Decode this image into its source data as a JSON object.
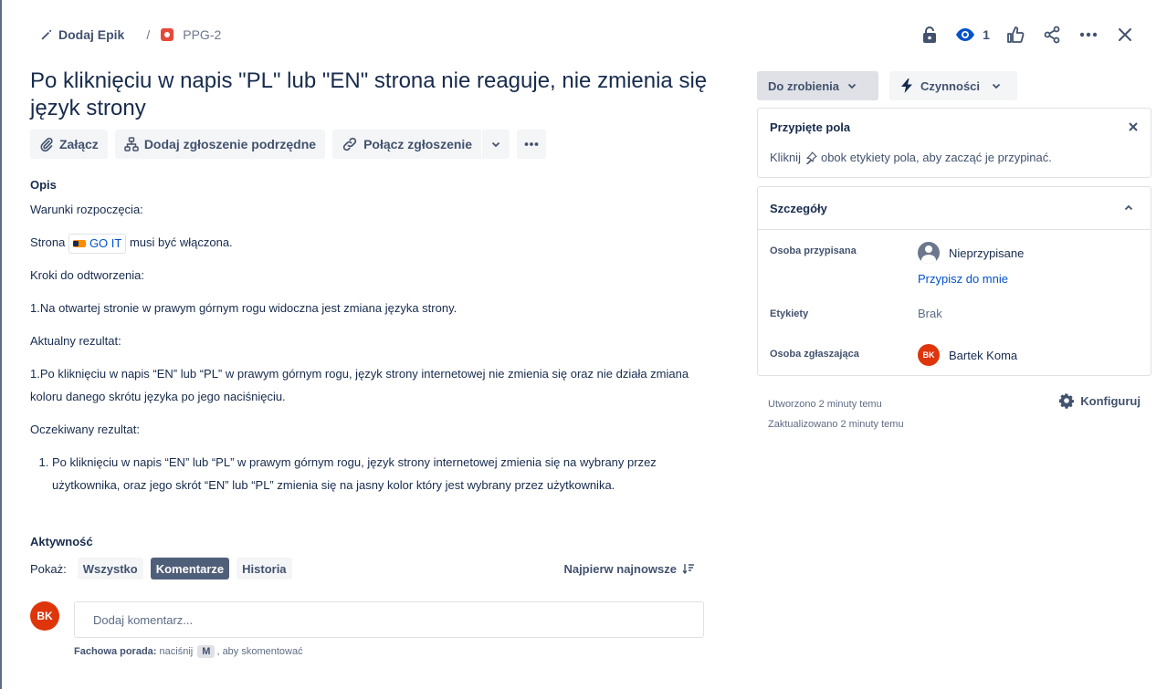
{
  "breadcrumb": {
    "epic_label": "Dodaj Epik",
    "separator": "/",
    "issue_key": "PPG-2"
  },
  "top_actions": {
    "watch_count": "1"
  },
  "issue": {
    "title": "Po kliknięciu w napis \"PL\" lub \"EN\" strona nie reaguje, nie zmienia się język strony"
  },
  "toolbar": {
    "attach": "Załącz",
    "add_child": "Dodaj zgłoszenie podrzędne",
    "link_issue": "Połącz zgłoszenie"
  },
  "description": {
    "heading": "Opis",
    "preconditions": "Warunki rozpoczęcia:",
    "page_prefix": "Strona",
    "smartlink_text": "GO IT",
    "page_suffix": "musi być włączona.",
    "steps_heading": "Kroki do odtworzenia:",
    "step1": "1.Na otwartej stronie w prawym górnym rogu widoczna jest zmiana języka strony.",
    "actual_heading": "Aktualny rezultat:",
    "actual_text": "1.Po kliknięciu w napis “EN” lub “PL” w prawym górnym rogu, język strony internetowej nie zmienia się oraz nie działa zmiana koloru danego skrótu języka po jego naciśnięciu.",
    "expected_heading": "Oczekiwany rezultat:",
    "expected_item": "Po kliknięciu w napis “EN” lub “PL” w prawym górnym rogu, język strony internetowej zmienia się na wybrany przez użytkownika, oraz jego skrót “EN” lub “PL” zmienia się na jasny kolor który jest wybrany przez użytkownika."
  },
  "activity": {
    "heading": "Aktywność",
    "show_label": "Pokaż:",
    "filters": [
      "Wszystko",
      "Komentarze",
      "Historia"
    ],
    "active_filter": "Komentarze",
    "sort_label": "Najpierw najnowsze",
    "avatar_initials": "BK",
    "comment_placeholder": "Dodaj komentarz...",
    "protip_bold": "Fachowa porada:",
    "protip_pre": "naciśnij",
    "protip_key": "M",
    "protip_post": ", aby skomentować"
  },
  "status": {
    "current": "Do zrobienia",
    "actions_label": "Czynności"
  },
  "pinned": {
    "title": "Przypięte pola",
    "hint_pre": "Kliknij",
    "hint_post": "obok etykiety pola, aby zacząć je przypinać."
  },
  "details": {
    "title": "Szczegóły",
    "assignee_label": "Osoba przypisana",
    "assignee_value": "Nieprzypisane",
    "assign_to_me": "Przypisz do mnie",
    "labels_label": "Etykiety",
    "labels_value": "Brak",
    "reporter_label": "Osoba zgłaszająca",
    "reporter_initials": "BK",
    "reporter_name": "Bartek Koma"
  },
  "meta": {
    "created": "Utworzono 2 minuty temu",
    "updated": "Zaktualizowano 2 minuty temu",
    "configure": "Konfiguruj"
  }
}
